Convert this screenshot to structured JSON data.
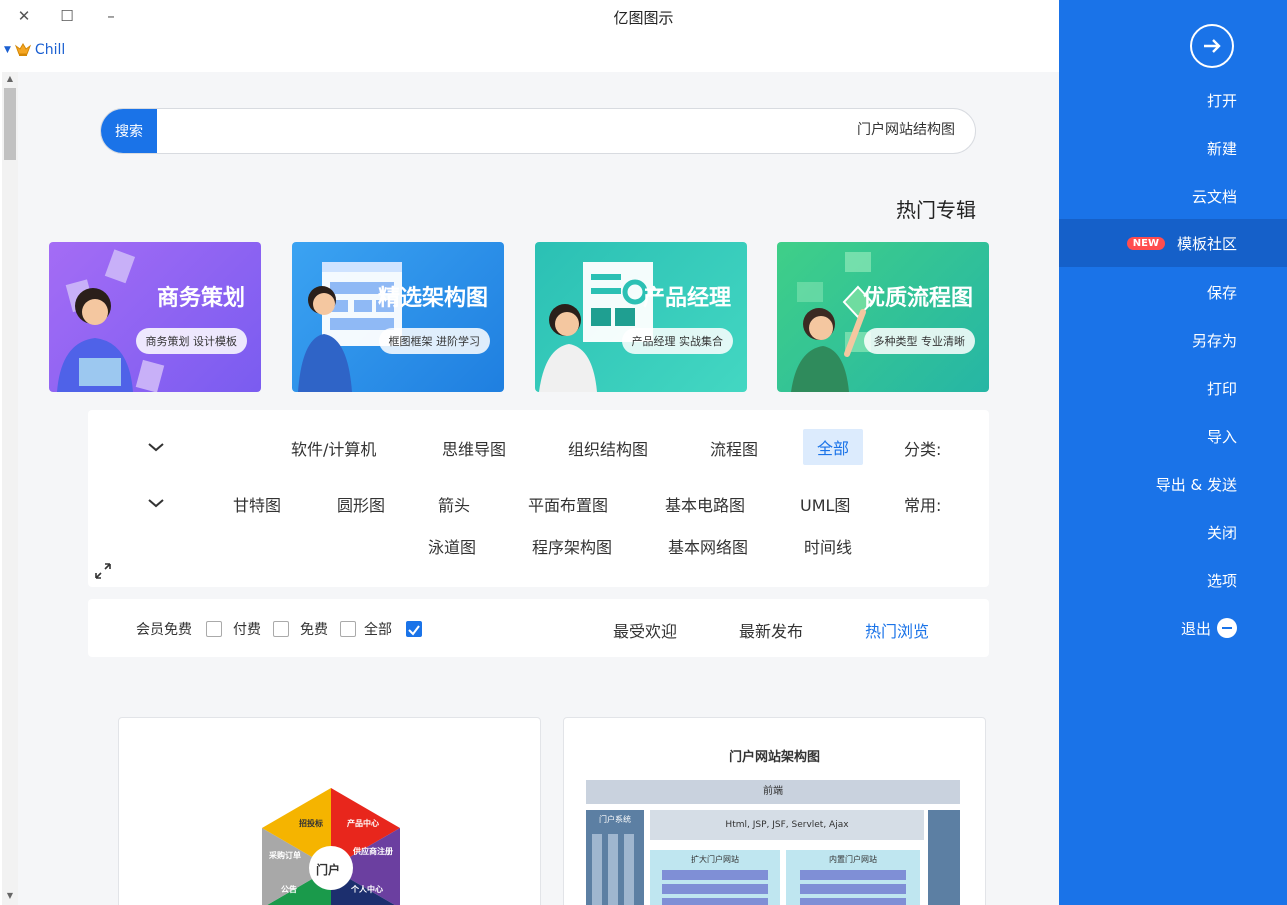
{
  "window": {
    "title": "亿图图示",
    "close": "✕",
    "maximize": "☐",
    "minimize": "–"
  },
  "user": {
    "name": "Chill"
  },
  "search": {
    "button": "搜索",
    "value": "门户网站结构图"
  },
  "hot": {
    "title": "热门专辑",
    "banners": [
      {
        "title": "优质流程图",
        "subtitle": "多种类型 专业清晰"
      },
      {
        "title": "产品经理",
        "subtitle": "产品经理 实战集合"
      },
      {
        "title": "精选架构图",
        "subtitle": "框图框架 进阶学习"
      },
      {
        "title": "商务策划",
        "subtitle": "商务策划 设计模板"
      }
    ]
  },
  "filter": {
    "category_label": "分类:",
    "categories": [
      "全部",
      "流程图",
      "组织结构图",
      "思维导图",
      "软件/计算机"
    ],
    "common_label": "常用:",
    "common_row1": [
      "UML图",
      "基本电路图",
      "平面布置图",
      "箭头",
      "圆形图",
      "甘特图"
    ],
    "common_row2": [
      "时间线",
      "基本网络图",
      "程序架构图",
      "泳道图"
    ]
  },
  "sort": {
    "tabs": [
      "热门浏览",
      "最新发布",
      "最受欢迎"
    ],
    "checks": [
      {
        "label": "全部",
        "checked": true
      },
      {
        "label": "免费",
        "checked": false
      },
      {
        "label": "付费",
        "checked": false
      },
      {
        "label": "会员免费",
        "checked": false
      }
    ]
  },
  "cards": [
    {
      "title": "门户网站架构图",
      "band": "前端",
      "tech": "Html, JSP, JSF, Servlet, Ajax",
      "left_label": "门户系统",
      "sub1": "内置门户网站",
      "sub2": "扩大门户网站"
    },
    {
      "center": "门户",
      "segments": [
        "产品中心",
        "供应商注册",
        "个人中心",
        "公告",
        "采购订单",
        "招投标"
      ]
    }
  ],
  "sidebar": {
    "items": [
      "打开",
      "新建",
      "云文档",
      "模板社区",
      "保存",
      "另存为",
      "打印",
      "导入",
      "导出 & 发送",
      "关闭",
      "选项",
      "退出"
    ],
    "new_badge": "NEW"
  },
  "colors": {
    "accent": "#1a73e8",
    "sidebar_active": "#1560c9",
    "badge": "#ff4d4f"
  }
}
